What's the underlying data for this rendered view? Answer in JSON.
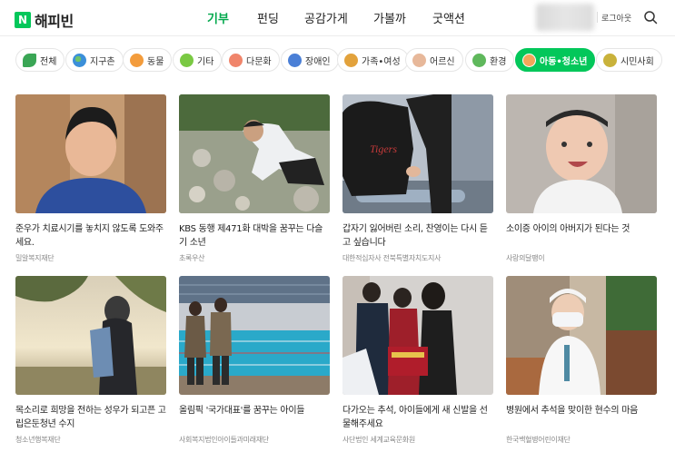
{
  "brand": {
    "badge": "N",
    "name": "해피빈"
  },
  "nav": [
    {
      "label": "기부",
      "active": true
    },
    {
      "label": "펀딩",
      "active": false
    },
    {
      "label": "공감가게",
      "active": false
    },
    {
      "label": "가볼까",
      "active": false
    },
    {
      "label": "굿액션",
      "active": false
    }
  ],
  "header": {
    "login": "로그아웃"
  },
  "categories": [
    {
      "label": "전체",
      "icon": "leaf-icon",
      "color": "#3aa655",
      "active": false
    },
    {
      "label": "지구촌",
      "icon": "globe-icon",
      "color": "#3b8fd9",
      "active": false
    },
    {
      "label": "동물",
      "icon": "tiger-icon",
      "color": "#f39c3c",
      "active": false
    },
    {
      "label": "기타",
      "icon": "dots-icon",
      "color": "#7ac943",
      "active": false
    },
    {
      "label": "다문화",
      "icon": "hearts-icon",
      "color": "#f0856b",
      "active": false
    },
    {
      "label": "장애인",
      "icon": "wheelchair-icon",
      "color": "#4a7fd6",
      "active": false
    },
    {
      "label": "가족•여성",
      "icon": "house-icon",
      "color": "#e2a23c",
      "active": false
    },
    {
      "label": "어르신",
      "icon": "elder-icon",
      "color": "#e7b89a",
      "active": false
    },
    {
      "label": "환경",
      "icon": "sprout-icon",
      "color": "#5fb85c",
      "active": false
    },
    {
      "label": "아동•청소년",
      "icon": "child-icon",
      "color": "#f2a65a",
      "active": true
    },
    {
      "label": "시민사회",
      "icon": "people-icon",
      "color": "#c9b23b",
      "active": false
    }
  ],
  "cards": [
    {
      "title": "준우가 치료시기를 놓치지 않도록 도와주세요.",
      "org": "밀알복지재단"
    },
    {
      "title": "KBS 동행 제471화 대박을 꿈꾸는 다슬기 소년",
      "org": "초록우산"
    },
    {
      "title": "갑자기 잃어버린 소리, 찬영이는 다시 듣고 싶습니다",
      "org": "대한적십자사 전북특별자치도지사"
    },
    {
      "title": "소이증 아이의 아버지가 된다는 것",
      "org": "사랑의달팽이"
    },
    {
      "title": "목소리로 희망을 전하는 성우가 되고픈 고립은둔청년 수지",
      "org": "청소년행복재단"
    },
    {
      "title": "올림픽 '국가대표'를 꿈꾸는 아이들",
      "org": "사회복지법인아이들과미래재단"
    },
    {
      "title": "다가오는 추석, 아이들에게 새 신발을 선물해주세요",
      "org": "사단법인 세계교육문화원"
    },
    {
      "title": "병원에서 추석을 맞이한 현수의 마음",
      "org": "한국백혈병어린이재단"
    }
  ],
  "colors": {
    "accent": "#03c75a",
    "nav_active": "#03a94d"
  }
}
